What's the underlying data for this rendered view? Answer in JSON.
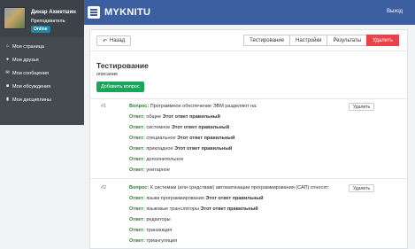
{
  "brand": {
    "name": "MYKNITU"
  },
  "header": {
    "logout": "Выход"
  },
  "user": {
    "name": "Динар Ахметшин",
    "role": "Преподаватель",
    "status": "Online"
  },
  "sidebar": {
    "items": [
      {
        "label": "Моя страница",
        "icon": "home-icon"
      },
      {
        "label": "Мои друзья",
        "icon": "user-icon"
      },
      {
        "label": "Мои сообщения",
        "icon": "envelope-icon"
      },
      {
        "label": "Мои обсуждения",
        "icon": "comments-icon"
      },
      {
        "label": "Мои дисциплины",
        "icon": "book-icon"
      }
    ]
  },
  "toolbar": {
    "back": "Назад",
    "tabs": [
      "Тестирование",
      "Настройки",
      "Результаты",
      "Удалить"
    ]
  },
  "test": {
    "title": "Тестирование",
    "description": "описание",
    "add_question": "Добавить вопрос"
  },
  "labels": {
    "question": "Вопрос:",
    "answer": "Ответ:",
    "correct": "Этот ответ правильный",
    "delete": "Удалить"
  },
  "questions": [
    {
      "num": "#1",
      "text": "Программное обеспечение ЭВМ разделяют на:",
      "answers": [
        {
          "text": "общее",
          "correct": "Этот ответ правильный"
        },
        {
          "text": "системное",
          "correct": "Этот ответ правильный"
        },
        {
          "text": "специальное",
          "correct": "Этот ответ правильный"
        },
        {
          "text": "прикладное",
          "correct": "Этот ответ правильный"
        },
        {
          "text": "дополнительное",
          "correct": ""
        },
        {
          "text": "унитарное",
          "correct": ""
        }
      ]
    },
    {
      "num": "#2",
      "text": "К системам (или средствам) автоматизации программирования (САП) относят:",
      "answers": [
        {
          "text": "языки программирования",
          "correct": "Этот ответ правильный"
        },
        {
          "text": "языковые трансляторы",
          "correct": "Этот ответ правильный"
        },
        {
          "text": "редакторы",
          "correct": ""
        },
        {
          "text": "транзакция",
          "correct": ""
        },
        {
          "text": "триангуляция",
          "correct": ""
        }
      ]
    }
  ]
}
